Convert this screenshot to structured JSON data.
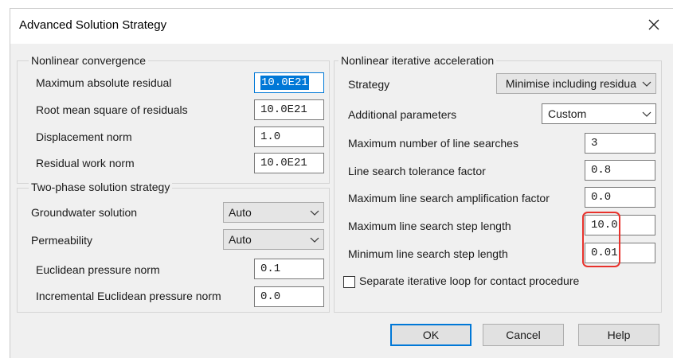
{
  "dialog": {
    "title": "Advanced Solution Strategy",
    "close_glyph": "×"
  },
  "nonlinear_convergence": {
    "title": "Nonlinear convergence",
    "rows": [
      {
        "label": "Maximum absolute residual",
        "value": "10.0E21"
      },
      {
        "label": "Root mean square of residuals",
        "value": "10.0E21"
      },
      {
        "label": "Displacement norm",
        "value": "1.0"
      },
      {
        "label": "Residual work norm",
        "value": "10.0E21"
      }
    ]
  },
  "two_phase": {
    "title": "Two-phase solution strategy",
    "groundwater": {
      "label": "Groundwater solution",
      "value": "Auto"
    },
    "permeability": {
      "label": "Permeability",
      "value": "Auto"
    },
    "euclidean": {
      "label": "Euclidean pressure norm",
      "value": "0.1"
    },
    "incremental": {
      "label": "Incremental Euclidean pressure norm",
      "value": "0.0"
    }
  },
  "acceleration": {
    "title": "Nonlinear iterative acceleration",
    "strategy": {
      "label": "Strategy",
      "value": "Minimise including residua"
    },
    "additional": {
      "label": "Additional parameters",
      "value": "Custom"
    },
    "rows": [
      {
        "label": "Maximum number of line searches",
        "value": "3"
      },
      {
        "label": "Line search tolerance factor",
        "value": "0.8"
      },
      {
        "label": "Maximum line search amplification factor",
        "value": "0.0"
      },
      {
        "label": "Maximum line search step length",
        "value": "10.0"
      },
      {
        "label": "Minimum line search step length",
        "value": "0.01"
      }
    ],
    "separate_loop": {
      "label": "Separate iterative loop for contact procedure",
      "checked": false
    }
  },
  "buttons": {
    "ok": "OK",
    "cancel": "Cancel",
    "help": "Help"
  },
  "colors": {
    "highlight": "#e8322c",
    "selection": "#0078d7"
  }
}
